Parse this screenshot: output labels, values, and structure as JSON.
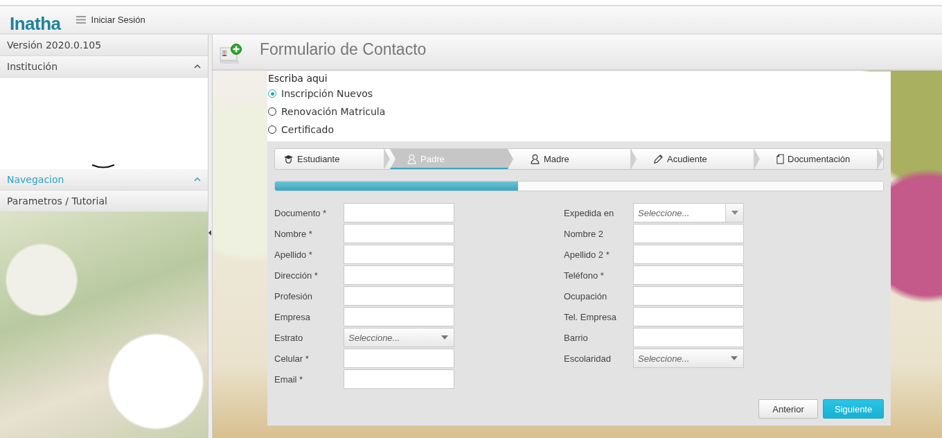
{
  "header": {
    "logo": "Inatha",
    "login_link": "Iniciar Sesión"
  },
  "sidebar": {
    "version": "Versión 2020.0.105",
    "sections": [
      {
        "title": "Institución",
        "expanded": true,
        "selected": false,
        "kind": "panel"
      },
      {
        "title": "Navegacion",
        "expanded": true,
        "selected": true,
        "kind": "header"
      },
      {
        "title": "Parametros / Tutorial",
        "expanded": false,
        "selected": false,
        "kind": "item"
      }
    ]
  },
  "page": {
    "title": "Formulario de Contacto"
  },
  "form": {
    "prompt": "Escriba aqui",
    "options": [
      {
        "label": "Inscripción Nuevos",
        "selected": true
      },
      {
        "label": "Renovación Matricula",
        "selected": false
      },
      {
        "label": "Certificado",
        "selected": false
      }
    ],
    "steps": [
      {
        "label": "Estudiante",
        "selected": false,
        "kind": "student"
      },
      {
        "label": "Padre",
        "selected": true,
        "kind": "parent"
      },
      {
        "label": "Madre",
        "selected": false,
        "kind": "parent"
      },
      {
        "label": "Acudiente",
        "selected": false,
        "kind": "guardian"
      },
      {
        "label": "Documentación",
        "selected": false,
        "kind": "documents"
      }
    ],
    "progress": {
      "level": 0.4
    },
    "left_fields": [
      {
        "label": "Documento *",
        "kind": "text"
      },
      {
        "label": "Nombre *",
        "kind": "text"
      },
      {
        "label": "Apellido *",
        "kind": "text"
      },
      {
        "label": "Dirección *",
        "kind": "text"
      },
      {
        "label": "Profesión",
        "kind": "text"
      },
      {
        "label": "Empresa",
        "kind": "text"
      },
      {
        "label": "Estrato",
        "kind": "select",
        "placeholder": "Seleccione..."
      },
      {
        "label": "Celular *",
        "kind": "text"
      },
      {
        "label": "Email *",
        "kind": "text"
      }
    ],
    "right_fields": [
      {
        "label": "Expedida en",
        "kind": "combo",
        "placeholder": "Seleccione..."
      },
      {
        "label": "Nombre 2",
        "kind": "text"
      },
      {
        "label": "Apellido 2 *",
        "kind": "text"
      },
      {
        "label": "Teléfono *",
        "kind": "text"
      },
      {
        "label": "Ocupación",
        "kind": "text"
      },
      {
        "label": "Tel. Empresa",
        "kind": "text"
      },
      {
        "label": "Barrio",
        "kind": "text"
      },
      {
        "label": "Escolaridad",
        "kind": "select",
        "placeholder": "Seleccione..."
      }
    ],
    "buttons": [
      {
        "label": "Anterior",
        "kind": "secondary"
      },
      {
        "label": "Siguiente",
        "kind": "primary"
      }
    ]
  }
}
